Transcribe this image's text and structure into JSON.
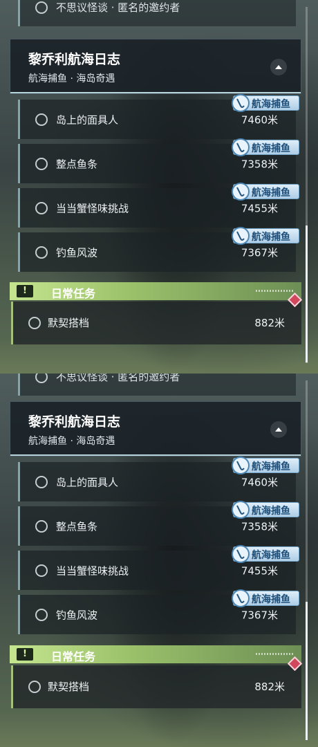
{
  "panels": [
    {
      "cut_task": "不思议怪谈 · 匿名的邀约者",
      "header": {
        "title": "黎乔利航海日志",
        "subtitle": "航海捕鱼 · 海岛奇遇"
      },
      "tasks": [
        {
          "label": "岛上的面具人",
          "distance": "7460米",
          "tag": "航海捕鱼"
        },
        {
          "label": "整点鱼条",
          "distance": "7358米",
          "tag": "航海捕鱼"
        },
        {
          "label": "当当蟹怪味挑战",
          "distance": "7455米",
          "tag": "航海捕鱼"
        },
        {
          "label": "钓鱼风波",
          "distance": "7367米",
          "tag": "航海捕鱼"
        }
      ],
      "daily": {
        "title": "日常任务",
        "icon": "exclamation-icon",
        "task": {
          "label": "默契搭档",
          "distance": "882米"
        }
      }
    },
    {
      "cut_task": "不思议怪谈 · 匿名的邀约者",
      "header": {
        "title": "黎乔利航海日志",
        "subtitle": "航海捕鱼 · 海岛奇遇"
      },
      "tasks": [
        {
          "label": "岛上的面具人",
          "distance": "7460米",
          "tag": "航海捕鱼"
        },
        {
          "label": "整点鱼条",
          "distance": "7358米",
          "tag": "航海捕鱼"
        },
        {
          "label": "当当蟹怪味挑战",
          "distance": "7455米",
          "tag": "航海捕鱼"
        },
        {
          "label": "钓鱼风波",
          "distance": "7367米",
          "tag": "航海捕鱼"
        }
      ],
      "daily": {
        "title": "日常任务",
        "icon": "exclamation-icon",
        "task": {
          "label": "默契搭档",
          "distance": "882米"
        }
      }
    }
  ],
  "colors": {
    "daily_accent": "#c5e58f",
    "tag_text": "#1d4f7a",
    "marker": "#d1475c"
  }
}
